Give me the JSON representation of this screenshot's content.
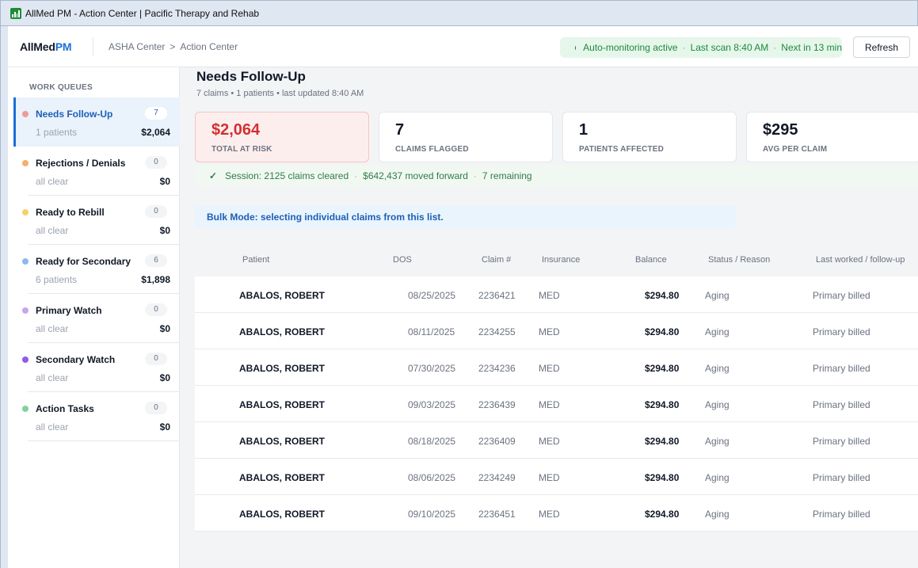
{
  "window": {
    "title": "AllMed PM - Action Center | Pacific Therapy and Rehab"
  },
  "header": {
    "brand_main": "AllMed",
    "brand_accent": "PM",
    "breadcrumb": [
      "ASHA Center",
      ">",
      "Action Center"
    ],
    "status": {
      "monitoring": "Auto-monitoring active",
      "last_scan": "Last scan 8:40 AM",
      "next": "Next in 13 min",
      "separator": "·"
    },
    "refresh_label": "Refresh"
  },
  "sidebar": {
    "title": "WORK QUEUES",
    "queues": [
      {
        "name": "Needs Follow-Up",
        "count": "7",
        "sub": "1 patients",
        "amount": "$2,064",
        "color": "#ef9a9a"
      },
      {
        "name": "Rejections / Denials",
        "count": "0",
        "sub": "all clear",
        "amount": "$0",
        "color": "#f6ae6b"
      },
      {
        "name": "Ready to Rebill",
        "count": "0",
        "sub": "all clear",
        "amount": "$0",
        "color": "#f5d16a"
      },
      {
        "name": "Ready for Secondary",
        "count": "6",
        "sub": "6 patients",
        "amount": "$1,898",
        "color": "#90b8f0"
      },
      {
        "name": "Primary Watch",
        "count": "0",
        "sub": "all clear",
        "amount": "$0",
        "color": "#c8a6ec"
      },
      {
        "name": "Secondary Watch",
        "count": "0",
        "sub": "all clear",
        "amount": "$0",
        "color": "#8f5ce6"
      },
      {
        "name": "Action Tasks",
        "count": "0",
        "sub": "all clear",
        "amount": "$0",
        "color": "#86cfa1"
      }
    ]
  },
  "main": {
    "title": "Needs Follow-Up",
    "subtitle": "7 claims • 1 patients • last updated 8:40 AM",
    "cards": [
      {
        "value": "$2,064",
        "label": "TOTAL AT RISK"
      },
      {
        "value": "7",
        "label": "CLAIMS FLAGGED"
      },
      {
        "value": "1",
        "label": "PATIENTS AFFECTED"
      },
      {
        "value": "$295",
        "label": "AVG PER CLAIM"
      }
    ],
    "session": {
      "check": "✓",
      "cleared": "Session: 2125 claims cleared",
      "moved": "$642,437 moved forward",
      "remaining": "7 remaining",
      "separator": "·"
    },
    "bulk_text": "Bulk Mode: selecting individual claims from this list.",
    "table": {
      "headers": [
        "Patient",
        "DOS",
        "Claim #",
        "Insurance",
        "Balance",
        "Status / Reason",
        "Last worked / follow-up"
      ],
      "rows": [
        {
          "patient": "ABALOS, ROBERT",
          "dos": "08/25/2025",
          "claim": "2236421",
          "insurance": "MED",
          "balance": "$294.80",
          "status": "Aging",
          "last": "Primary billed"
        },
        {
          "patient": "ABALOS, ROBERT",
          "dos": "08/11/2025",
          "claim": "2234255",
          "insurance": "MED",
          "balance": "$294.80",
          "status": "Aging",
          "last": "Primary billed"
        },
        {
          "patient": "ABALOS, ROBERT",
          "dos": "07/30/2025",
          "claim": "2234236",
          "insurance": "MED",
          "balance": "$294.80",
          "status": "Aging",
          "last": "Primary billed"
        },
        {
          "patient": "ABALOS, ROBERT",
          "dos": "09/03/2025",
          "claim": "2236439",
          "insurance": "MED",
          "balance": "$294.80",
          "status": "Aging",
          "last": "Primary billed"
        },
        {
          "patient": "ABALOS, ROBERT",
          "dos": "08/18/2025",
          "claim": "2236409",
          "insurance": "MED",
          "balance": "$294.80",
          "status": "Aging",
          "last": "Primary billed"
        },
        {
          "patient": "ABALOS, ROBERT",
          "dos": "08/06/2025",
          "claim": "2234249",
          "insurance": "MED",
          "balance": "$294.80",
          "status": "Aging",
          "last": "Primary billed"
        },
        {
          "patient": "ABALOS, ROBERT",
          "dos": "09/10/2025",
          "claim": "2236451",
          "insurance": "MED",
          "balance": "$294.80",
          "status": "Aging",
          "last": "Primary billed"
        }
      ]
    }
  }
}
